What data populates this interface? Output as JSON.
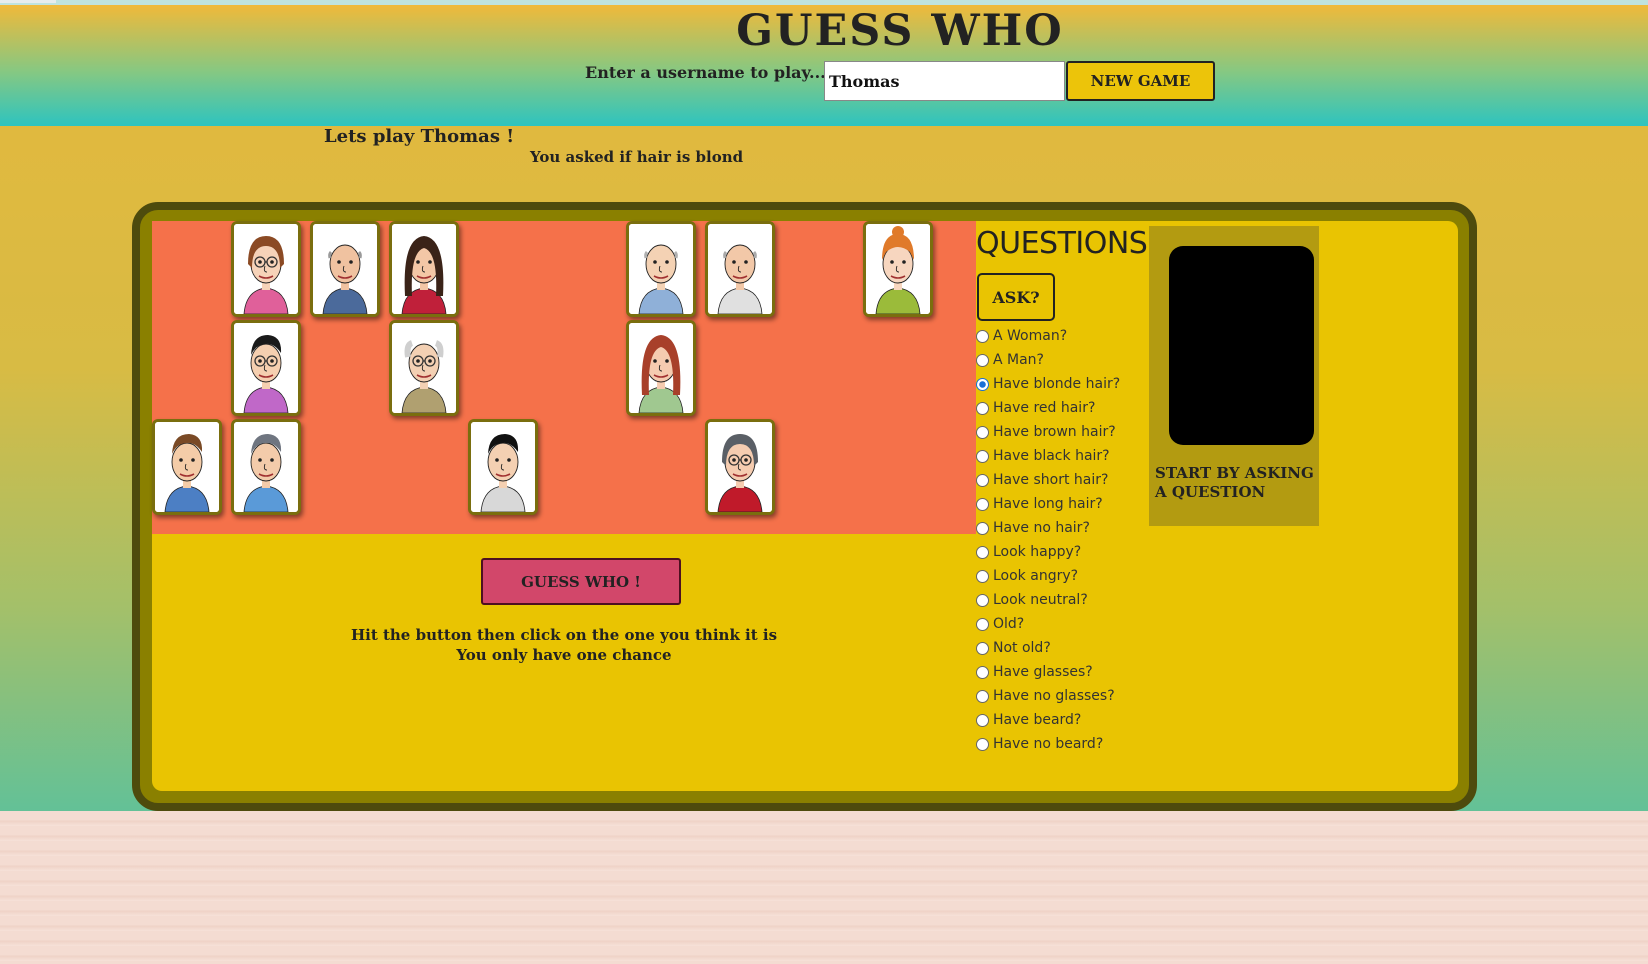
{
  "header": {
    "title": "GUESS WHO",
    "username_label": "Enter a username to play...",
    "username_value": "Thomas",
    "new_game_label": "NEW GAME"
  },
  "status": {
    "greeting": "Lets play Thomas !",
    "asked": "You asked if hair is blond"
  },
  "board": {
    "cards": [
      {
        "name": "woman-brown-bob-glasses",
        "row": 0,
        "col": 1
      },
      {
        "name": "angry-bald-man",
        "row": 0,
        "col": 2
      },
      {
        "name": "woman-long-dark-hair",
        "row": 0,
        "col": 3
      },
      {
        "name": "bald-man-small-face",
        "row": 0,
        "col": 6
      },
      {
        "name": "bald-man-tie",
        "row": 0,
        "col": 7
      },
      {
        "name": "woman-ginger-updo",
        "row": 0,
        "col": 9
      },
      {
        "name": "man-black-hair-bowtie",
        "row": 1,
        "col": 1
      },
      {
        "name": "old-man-glasses",
        "row": 1,
        "col": 3
      },
      {
        "name": "woman-auburn-hair",
        "row": 1,
        "col": 6
      },
      {
        "name": "man-brown-hair-smiling",
        "row": 2,
        "col": 0
      },
      {
        "name": "man-grey-hair",
        "row": 2,
        "col": 1
      },
      {
        "name": "man-black-quiff",
        "row": 2,
        "col": 4
      },
      {
        "name": "woman-grey-bob-glasses",
        "row": 2,
        "col": 7
      }
    ]
  },
  "guess": {
    "button_label": "GUESS WHO !",
    "hint_line1": "Hit the button then click on the one you think it is",
    "hint_line2": "You only have one chance"
  },
  "questions": {
    "title": "QUESTIONS",
    "ask_label": "ASK?",
    "selected_index": 2,
    "options": [
      "A Woman?",
      "A Man?",
      "Have blonde hair?",
      "Have red hair?",
      "Have brown hair?",
      "Have black hair?",
      "Have short hair?",
      "Have long hair?",
      "Have no hair?",
      "Look happy?",
      "Look angry?",
      "Look neutral?",
      "Old?",
      "Not old?",
      "Have glasses?",
      "Have no glasses?",
      "Have beard?",
      "Have no beard?"
    ]
  },
  "side": {
    "message": "START BY ASKING A QUESTION"
  }
}
